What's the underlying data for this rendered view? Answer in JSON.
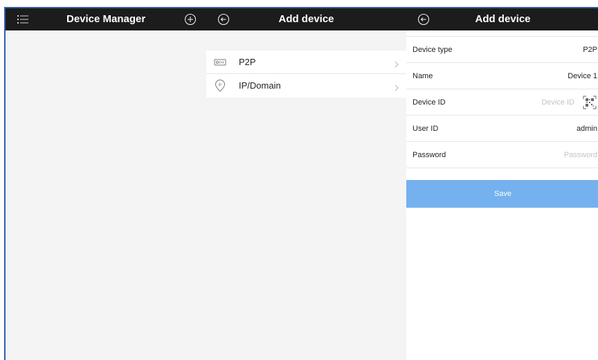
{
  "device_manager": {
    "title": "Device Manager",
    "menu_icon": "list-menu-icon",
    "add_icon": "plus-circle-icon"
  },
  "add_device_menu": {
    "title": "Add device",
    "back_icon": "back-arrow-icon",
    "items": [
      {
        "label": "P2P",
        "icon": "p2p-device-icon"
      },
      {
        "label": "IP/Domain",
        "icon": "ip-location-icon"
      }
    ]
  },
  "add_device_form": {
    "title": "Add device",
    "back_icon": "back-arrow-icon",
    "fields": {
      "device_type": {
        "label": "Device type",
        "value": "P2P"
      },
      "name": {
        "label": "Name",
        "value": "Device 1"
      },
      "device_id": {
        "label": "Device ID",
        "placeholder": "Device ID",
        "icon": "qr-scan-icon"
      },
      "user_id": {
        "label": "User ID",
        "value": "admin"
      },
      "password": {
        "label": "Password",
        "placeholder": "Password"
      }
    },
    "save_label": "Save"
  },
  "colors": {
    "title_bar": "#1c1c1c",
    "panel_background": "#f4f4f4",
    "save_button": "#74b1ee",
    "frame_border": "#2f5faa"
  }
}
